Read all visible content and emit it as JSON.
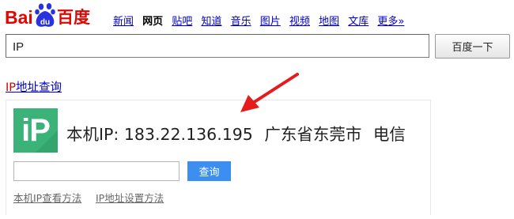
{
  "logo": {
    "text_bai": "Bai",
    "text_du_icon": "du",
    "text_name": "百度",
    "icon": "paw-icon"
  },
  "nav": {
    "items": [
      "新闻",
      "网页",
      "贴吧",
      "知道",
      "音乐",
      "图片",
      "视频",
      "地图",
      "文库",
      "更多»"
    ],
    "current_index": 1
  },
  "search": {
    "value": "IP",
    "button_label": "百度一下"
  },
  "result": {
    "title_prefix": "IP",
    "title_rest": "地址查询",
    "logo_text": "iP",
    "ip_label": "本机IP: 183.22.136.195",
    "location": "广东省东莞市",
    "isp": "电信",
    "query_value": "",
    "query_button": "查询",
    "links": [
      "本机IP查看方法",
      "IP地址设置方法"
    ]
  },
  "colors": {
    "brand_red": "#e10601",
    "baidu_blue": "#2932e1",
    "ip_green": "#3bb278",
    "query_blue": "#3c8ff1",
    "link_blue": "#0000cc"
  }
}
